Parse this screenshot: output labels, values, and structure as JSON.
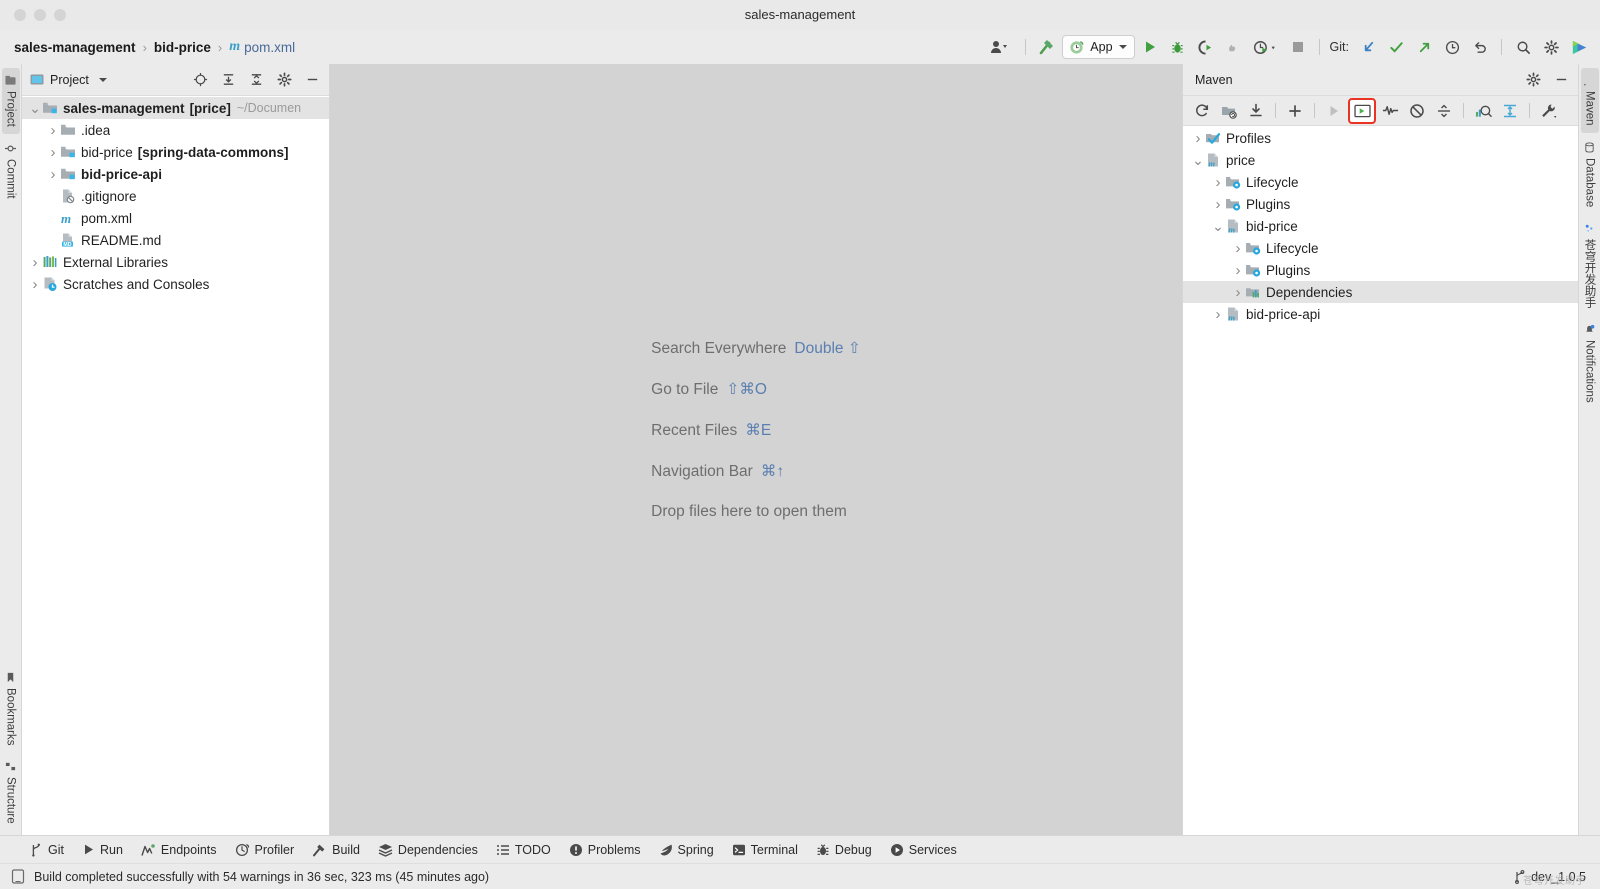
{
  "window": {
    "title": "sales-management",
    "traffic_lights": [
      "close",
      "minimize",
      "maximize"
    ]
  },
  "breadcrumb": {
    "items": [
      {
        "label": "sales-management",
        "type": "project"
      },
      {
        "label": "bid-price",
        "type": "module"
      },
      {
        "label": "pom.xml",
        "type": "file",
        "icon": "maven-m-icon"
      }
    ],
    "separator": "›"
  },
  "toolbar": {
    "user_icon": "user-avatar-icon",
    "build_icon": "hammer-build-icon",
    "run_config": {
      "label": "App",
      "icon": "spring-boot-icon"
    },
    "run_label": "Run",
    "debug_label": "Debug",
    "run_coverage_label": "Run with Coverage",
    "profiler_label": "Profiler",
    "stop_label": "Stop",
    "git_label": "Git:",
    "update_label": "Update Project",
    "commit_label": "Commit",
    "push_label": "Push",
    "history_label": "History",
    "rollback_label": "Rollback",
    "search_label": "Search",
    "settings_label": "Settings",
    "ai_assistant_label": "AI Assistant"
  },
  "left_strip": {
    "top": [
      {
        "label": "Project",
        "icon": "project-folder-icon",
        "active": true
      },
      {
        "label": "Commit",
        "icon": "commit-icon",
        "active": false
      }
    ],
    "bottom": [
      {
        "label": "Bookmarks",
        "icon": "bookmark-icon",
        "active": false
      },
      {
        "label": "Structure",
        "icon": "structure-icon",
        "active": false
      }
    ]
  },
  "right_strip": {
    "top": [
      {
        "label": "Maven",
        "icon": "maven-icon",
        "active": true
      },
      {
        "label": "Database",
        "icon": "database-icon",
        "active": false
      },
      {
        "label": "苍穹开发助手",
        "icon": "sparkle-icon",
        "active": false
      },
      {
        "label": "Notifications",
        "icon": "bell-icon",
        "active": false
      }
    ]
  },
  "project_panel": {
    "title": "Project",
    "dropdown_icon": "chevron-down-icon",
    "actions": [
      {
        "name": "select-opened-file",
        "icon": "crosshair-icon"
      },
      {
        "name": "expand-all",
        "icon": "expand-all-icon"
      },
      {
        "name": "collapse-all",
        "icon": "collapse-all-icon"
      },
      {
        "name": "options",
        "icon": "gear-icon"
      },
      {
        "name": "hide",
        "icon": "minimize-icon"
      }
    ],
    "tree": [
      {
        "indent": 0,
        "arrow": "down",
        "icon": "module-folder-icon",
        "label": "sales-management",
        "suffix": "[price]",
        "path": "~/Documen",
        "selected": true,
        "bold": true
      },
      {
        "indent": 1,
        "arrow": "right",
        "icon": "plain-folder-icon",
        "label": ".idea",
        "suffix": "",
        "path": "",
        "selected": false,
        "bold": false
      },
      {
        "indent": 1,
        "arrow": "right",
        "icon": "module-folder-icon",
        "label": "bid-price",
        "suffix": "[spring-data-commons]",
        "path": "",
        "selected": false,
        "bold": false
      },
      {
        "indent": 1,
        "arrow": "right",
        "icon": "module-folder-icon",
        "label": "bid-price-api",
        "suffix": "",
        "path": "",
        "selected": false,
        "bold": true
      },
      {
        "indent": 1,
        "arrow": "none",
        "icon": "gitignore-icon",
        "label": ".gitignore",
        "suffix": "",
        "path": "",
        "selected": false,
        "bold": false
      },
      {
        "indent": 1,
        "arrow": "none",
        "icon": "maven-m-icon",
        "label": "pom.xml",
        "suffix": "",
        "path": "",
        "selected": false,
        "bold": false
      },
      {
        "indent": 1,
        "arrow": "none",
        "icon": "markdown-icon",
        "label": "README.md",
        "suffix": "",
        "path": "",
        "selected": false,
        "bold": false
      },
      {
        "indent": 0,
        "arrow": "right",
        "icon": "libraries-icon",
        "label": "External Libraries",
        "suffix": "",
        "path": "",
        "selected": false,
        "bold": false
      },
      {
        "indent": 0,
        "arrow": "right",
        "icon": "scratches-icon",
        "label": "Scratches and Consoles",
        "suffix": "",
        "path": "",
        "selected": false,
        "bold": false
      }
    ]
  },
  "editor": {
    "hints": [
      {
        "text": "Search Everywhere",
        "keys": "Double ⇧"
      },
      {
        "text": "Go to File",
        "keys": "⇧⌘O"
      },
      {
        "text": "Recent Files",
        "keys": "⌘E"
      },
      {
        "text": "Navigation Bar",
        "keys": "⌘↑"
      },
      {
        "text": "Drop files here to open them",
        "keys": ""
      }
    ]
  },
  "maven_panel": {
    "title": "Maven",
    "header_actions": [
      {
        "name": "settings",
        "icon": "gear-icon"
      },
      {
        "name": "hide",
        "icon": "minimize-icon"
      }
    ],
    "toolbar": [
      {
        "name": "reload-all-maven-projects",
        "icon": "reload-icon",
        "disabled": false,
        "highlighted": false
      },
      {
        "name": "add-maven-project",
        "icon": "add-folder-icon",
        "disabled": false,
        "highlighted": false
      },
      {
        "name": "download-sources",
        "icon": "download-icon",
        "disabled": false,
        "highlighted": false
      },
      {
        "name": "add-maven-goal",
        "icon": "plus-icon",
        "disabled": false,
        "highlighted": false
      },
      {
        "name": "run-maven-build",
        "icon": "run-icon",
        "disabled": true,
        "highlighted": false
      },
      {
        "name": "execute-maven-goal",
        "icon": "execute-goal-icon",
        "disabled": false,
        "highlighted": true
      },
      {
        "name": "toggle-skip-tests",
        "icon": "skip-tests-icon",
        "disabled": false,
        "highlighted": false
      },
      {
        "name": "toggle-offline-mode",
        "icon": "offline-icon",
        "disabled": false,
        "highlighted": false
      },
      {
        "name": "collapse-all",
        "icon": "collapse-all-icon",
        "disabled": false,
        "highlighted": false
      },
      {
        "name": "show-dependency-analyzer",
        "icon": "dependency-analyzer-icon",
        "disabled": false,
        "highlighted": false
      },
      {
        "name": "expand-dependencies",
        "icon": "expand-width-icon",
        "disabled": false,
        "highlighted": false
      },
      {
        "name": "maven-settings",
        "icon": "wrench-icon",
        "disabled": false,
        "highlighted": false
      }
    ],
    "tree": [
      {
        "indent": 0,
        "arrow": "right",
        "icon": "profiles-icon",
        "label": "Profiles",
        "selected": false
      },
      {
        "indent": 0,
        "arrow": "down",
        "icon": "maven-project-icon",
        "label": "price",
        "selected": false
      },
      {
        "indent": 1,
        "arrow": "right",
        "icon": "phase-folder-icon",
        "label": "Lifecycle",
        "selected": false
      },
      {
        "indent": 1,
        "arrow": "right",
        "icon": "phase-folder-icon",
        "label": "Plugins",
        "selected": false
      },
      {
        "indent": 1,
        "arrow": "down",
        "icon": "maven-project-icon",
        "label": "bid-price",
        "selected": false
      },
      {
        "indent": 2,
        "arrow": "right",
        "icon": "phase-folder-icon",
        "label": "Lifecycle",
        "selected": false
      },
      {
        "indent": 2,
        "arrow": "right",
        "icon": "phase-folder-icon",
        "label": "Plugins",
        "selected": false
      },
      {
        "indent": 2,
        "arrow": "right",
        "icon": "dependencies-icon",
        "label": "Dependencies",
        "selected": true
      },
      {
        "indent": 1,
        "arrow": "right",
        "icon": "maven-project-icon",
        "label": "bid-price-api",
        "selected": false
      }
    ]
  },
  "tool_window_bar": [
    {
      "label": "Git",
      "icon": "git-branch-icon"
    },
    {
      "label": "Run",
      "icon": "run-icon"
    },
    {
      "label": "Endpoints",
      "icon": "endpoints-icon"
    },
    {
      "label": "Profiler",
      "icon": "profiler-icon"
    },
    {
      "label": "Build",
      "icon": "hammer-build-icon"
    },
    {
      "label": "Dependencies",
      "icon": "dependencies-stack-icon"
    },
    {
      "label": "TODO",
      "icon": "todo-list-icon"
    },
    {
      "label": "Problems",
      "icon": "problems-icon"
    },
    {
      "label": "Spring",
      "icon": "spring-leaf-icon"
    },
    {
      "label": "Terminal",
      "icon": "terminal-icon"
    },
    {
      "label": "Debug",
      "icon": "debug-bug-icon"
    },
    {
      "label": "Services",
      "icon": "services-icon"
    }
  ],
  "status_bar": {
    "icon": "build-status-icon",
    "message": "Build completed successfully with 54 warnings in 36 sec, 323 ms (45 minutes ago)",
    "branch": "dev_1.0.5",
    "branch_icon": "git-branch-icon",
    "watermark": "苍穹开发助手"
  },
  "colors": {
    "accent_blue": "#4a6a99",
    "highlight_red": "#ea3323",
    "run_green": "#59a869",
    "maven_blue": "#3b9ec7",
    "panel_bg": "#ebebeb",
    "editor_bg": "#d3d3d3",
    "selection": "#d6d6d6"
  }
}
